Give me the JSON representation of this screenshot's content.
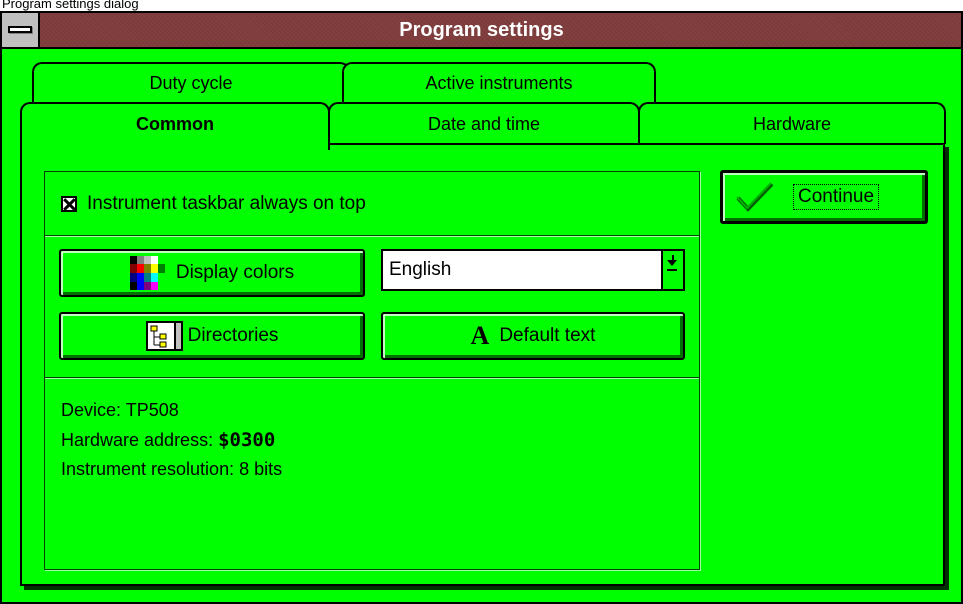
{
  "caption": "Program settings dialog",
  "window": {
    "title": "Program settings"
  },
  "tabs": {
    "back": [
      "Duty cycle",
      "Active instruments"
    ],
    "front": [
      "Common",
      "Date and time",
      "Hardware"
    ],
    "active": "Common"
  },
  "common": {
    "checkbox": {
      "label": "Instrument taskbar always on top",
      "checked": true
    },
    "buttons": {
      "display_colors": "Display colors",
      "directories": "Directories",
      "default_text": "Default text",
      "default_text_glyph": "A"
    },
    "language": {
      "value": "English"
    },
    "info": {
      "device_label": "Device:",
      "device_value": "TP508",
      "address_label": "Hardware address:",
      "address_value": "$0300",
      "resolution_label": "Instrument resolution:",
      "resolution_value": "8 bits"
    }
  },
  "continue_button": {
    "label": "Continue"
  },
  "colors": {
    "background": "#00ff00",
    "titlebar": "#844040",
    "title_text": "#ffffff"
  },
  "icons": [
    "system-menu-icon",
    "color-palette-icon",
    "directory-tree-icon",
    "font-icon",
    "dropdown-arrow-icon",
    "checkmark-icon"
  ]
}
